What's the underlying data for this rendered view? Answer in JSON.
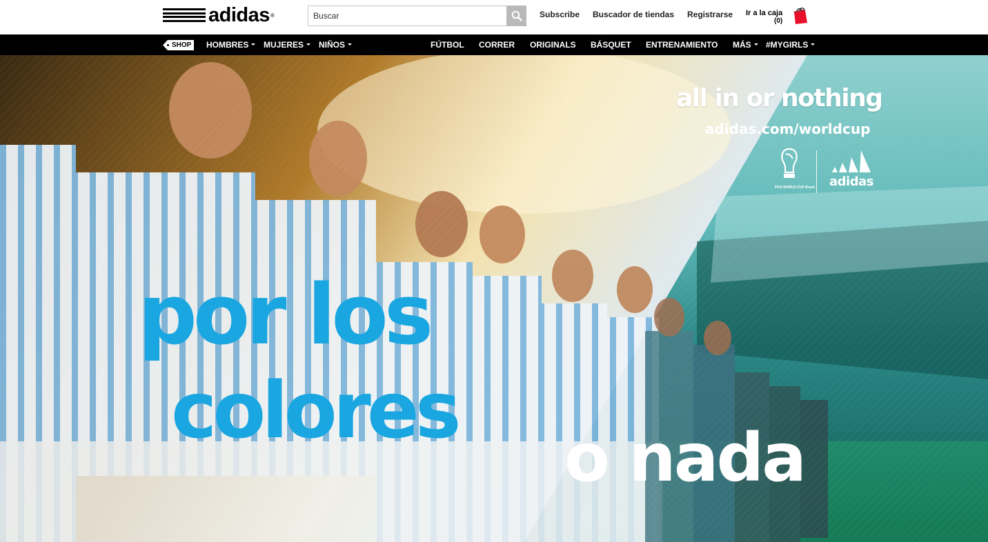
{
  "header": {
    "logo_text": "adidas",
    "logo_mark": "®",
    "search": {
      "placeholder": "Buscar",
      "icon": "search-icon"
    },
    "links": {
      "subscribe": "Subscribe",
      "store_finder": "Buscador de tiendas",
      "register": "Registrarse"
    },
    "cart": {
      "label": "Ir a la caja",
      "count": "(0)",
      "icon": "shopping-bag-icon",
      "color": "#e8102b"
    }
  },
  "nav": {
    "shop_tag": "SHOP",
    "left_items": [
      {
        "label": "HOMBRES",
        "dropdown": true
      },
      {
        "label": "MUJERES",
        "dropdown": true
      },
      {
        "label": "NIÑOS",
        "dropdown": true
      }
    ],
    "right_items": [
      {
        "label": "FÚTBOL",
        "dropdown": false
      },
      {
        "label": "CORRER",
        "dropdown": false
      },
      {
        "label": "ORIGINALS",
        "dropdown": false
      },
      {
        "label": "BÁSQUET",
        "dropdown": false
      },
      {
        "label": "ENTRENAMIENTO",
        "dropdown": false
      },
      {
        "label": "MÁS",
        "dropdown": true
      },
      {
        "label": "#MYGIRLS",
        "dropdown": true
      }
    ]
  },
  "hero": {
    "tagline": "all in or nothing",
    "url": "adidas.com/worldcup",
    "emblem_text": "FIFA WORLD CUP Brasil",
    "partner_logo_text": "adidas",
    "headline_line1": "por los",
    "headline_line2": "colores",
    "headline_line3": "o nada",
    "accent_color": "#1aa6e0"
  }
}
